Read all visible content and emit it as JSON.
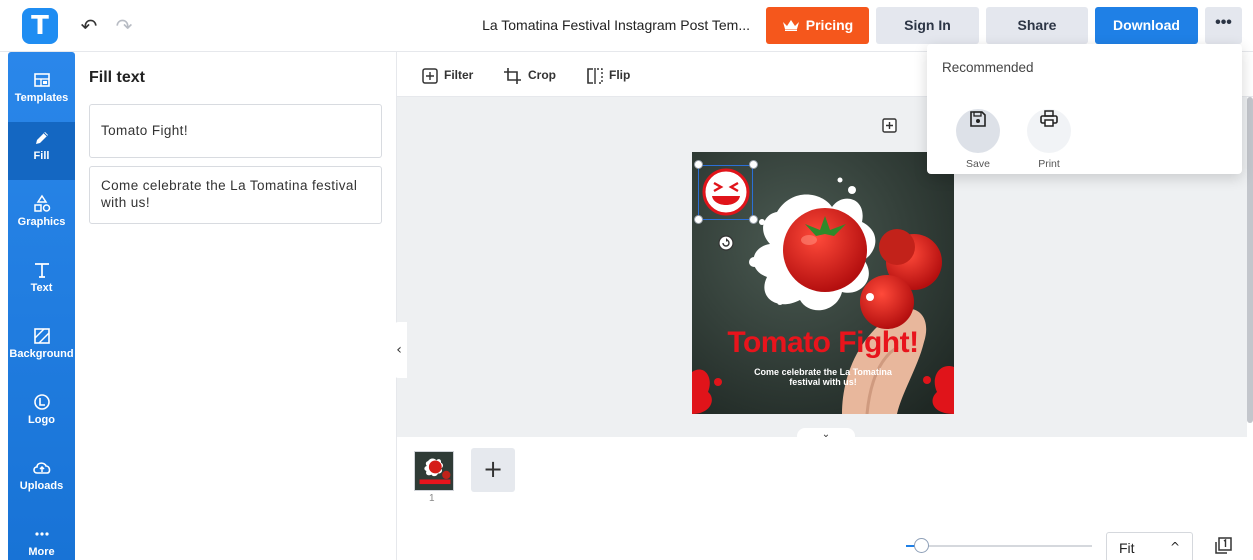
{
  "header": {
    "logo_letter": "T",
    "document_title": "La Tomatina Festival Instagram Post Tem...",
    "undo_glyph": "↶",
    "redo_glyph": "↷",
    "pricing_label": "Pricing",
    "signin_label": "Sign In",
    "share_label": "Share",
    "download_label": "Download",
    "more_label": "•••"
  },
  "sidebar": {
    "items": [
      {
        "label": "Templates",
        "icon": "templates-icon"
      },
      {
        "label": "Fill",
        "icon": "pencil-icon",
        "active": true
      },
      {
        "label": "Graphics",
        "icon": "shapes-icon"
      },
      {
        "label": "Text",
        "icon": "text-icon"
      },
      {
        "label": "Background",
        "icon": "background-icon"
      },
      {
        "label": "Logo",
        "icon": "logo-icon"
      },
      {
        "label": "Uploads",
        "icon": "upload-cloud-icon"
      },
      {
        "label": "More",
        "icon": "more-dots-icon"
      }
    ]
  },
  "panel": {
    "title": "Fill text",
    "fields": [
      {
        "value": "Tomato Fight!"
      },
      {
        "value": "Come celebrate the La Tomatina festival with us!"
      }
    ]
  },
  "toolbar": {
    "filter_label": "Filter",
    "crop_label": "Crop",
    "flip_label": "Flip"
  },
  "canvas": {
    "heading": "Tomato Fight!",
    "subtext": "Come celebrate the La Tomatina festival with us!",
    "collapse_glyph": "‹",
    "expand_glyph": "⌄"
  },
  "pages": {
    "thumb_number": "1",
    "add_glyph": "+"
  },
  "zoom": {
    "value": "Fit",
    "chevron": "^",
    "level_fraction": 0.08
  },
  "download_menu": {
    "title": "Recommended",
    "items": [
      {
        "label": "Save",
        "icon": "save-icon"
      },
      {
        "label": "Print",
        "icon": "print-icon"
      }
    ]
  },
  "colors": {
    "brand": "#1f8df2",
    "pricing": "#f5571c",
    "download": "#1f80e6",
    "headline": "#e8141c"
  }
}
